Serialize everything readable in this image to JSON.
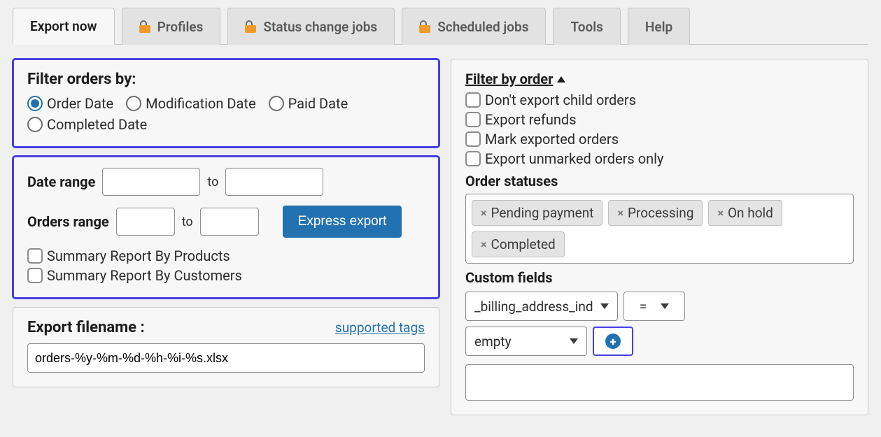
{
  "tabs": [
    {
      "label": "Export now",
      "active": true,
      "locked": false
    },
    {
      "label": "Profiles",
      "active": false,
      "locked": true
    },
    {
      "label": "Status change jobs",
      "active": false,
      "locked": true
    },
    {
      "label": "Scheduled jobs",
      "active": false,
      "locked": true
    },
    {
      "label": "Tools",
      "active": false,
      "locked": false
    },
    {
      "label": "Help",
      "active": false,
      "locked": false
    }
  ],
  "filter_by": {
    "title": "Filter orders by:",
    "options": [
      {
        "label": "Order Date",
        "checked": true
      },
      {
        "label": "Modification Date",
        "checked": false
      },
      {
        "label": "Paid Date",
        "checked": false
      },
      {
        "label": "Completed Date",
        "checked": false
      }
    ]
  },
  "ranges": {
    "date_label": "Date range",
    "date_from": "",
    "date_to": "",
    "orders_label": "Orders range",
    "orders_from": "",
    "orders_to": "",
    "to_word": "to",
    "express_btn": "Express export",
    "summary": [
      {
        "label": "Summary Report By Products",
        "checked": false
      },
      {
        "label": "Summary Report By Customers",
        "checked": false
      }
    ]
  },
  "export_filename": {
    "label": "Export filename :",
    "supported_tags": "supported tags",
    "value": "orders-%y-%m-%d-%h-%i-%s.xlsx"
  },
  "right": {
    "filter_header": "Filter by order ",
    "checks": [
      {
        "label": "Don't export child orders",
        "checked": false
      },
      {
        "label": "Export refunds",
        "checked": false
      },
      {
        "label": "Mark exported orders",
        "checked": false
      },
      {
        "label": "Export unmarked orders only",
        "checked": false
      }
    ],
    "order_statuses_label": "Order statuses",
    "status_chips": [
      "Pending payment",
      "Processing",
      "On hold",
      "Completed"
    ],
    "custom_fields_label": "Custom fields",
    "cf_field": "_billing_address_index",
    "cf_op": "=",
    "cf_val": "empty",
    "cf_result": ""
  }
}
